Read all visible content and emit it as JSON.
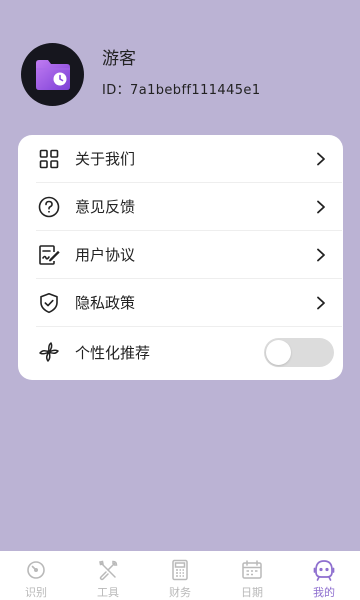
{
  "colors": {
    "background": "#bbb3d4",
    "card": "#ffffff",
    "accent": "#8e6fcf",
    "inactive": "#b9b9b9",
    "toggle_off": "#dcdcdc"
  },
  "profile": {
    "avatar_icon": "purple-folder-clock-icon",
    "name": "游客",
    "id_text": "ID：7a1bebff111445e1"
  },
  "menu": {
    "items": [
      {
        "label": "关于我们",
        "icon": "grid-icon"
      },
      {
        "label": "意见反馈",
        "icon": "question-circle-icon"
      },
      {
        "label": "用户协议",
        "icon": "document-pen-icon"
      },
      {
        "label": "隐私政策",
        "icon": "shield-check-icon"
      }
    ],
    "recommend": {
      "label": "个性化推荐",
      "icon": "pinwheel-icon",
      "enabled": false
    }
  },
  "bottom_nav": {
    "items": [
      {
        "label": "识别",
        "icon": "gauge-icon",
        "active": false
      },
      {
        "label": "工具",
        "icon": "tools-icon",
        "active": false
      },
      {
        "label": "财务",
        "icon": "calculator-icon",
        "active": false
      },
      {
        "label": "日期",
        "icon": "calendar-icon",
        "active": false
      },
      {
        "label": "我的",
        "icon": "robot-face-icon",
        "active": true
      }
    ]
  }
}
